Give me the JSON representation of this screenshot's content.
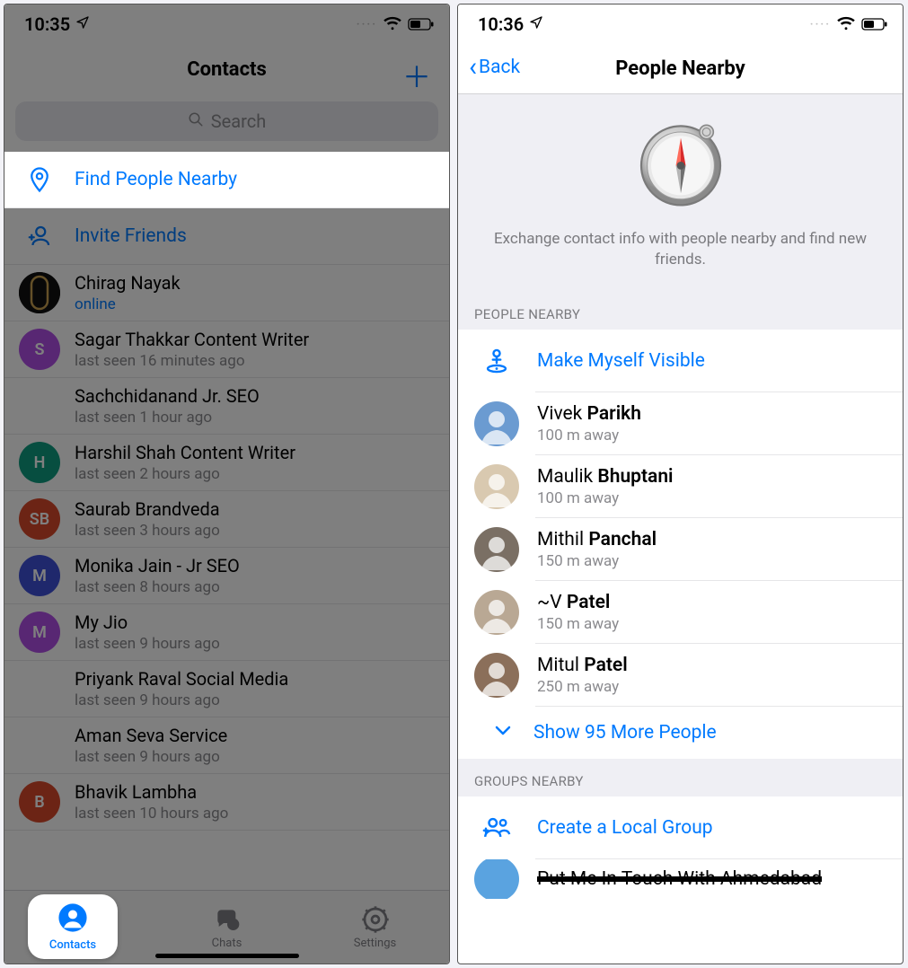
{
  "left": {
    "status": {
      "time": "10:35",
      "dots": "····"
    },
    "nav": {
      "title": "Contacts"
    },
    "search": {
      "placeholder": "Search"
    },
    "actions": {
      "find_nearby": "Find People Nearby",
      "invite": "Invite Friends"
    },
    "contacts": [
      {
        "name": "Chirag Nayak",
        "sub": "online",
        "sub_blue": true,
        "initials": "",
        "color": "#1b1b1b"
      },
      {
        "name": "Sagar Thakkar Content Writer",
        "sub": "last seen 16 minutes ago",
        "initials": "S",
        "color": "#b04fe6"
      },
      {
        "name": "Sachchidanand Jr. SEO",
        "sub": "last seen 1 hour ago",
        "indent": true
      },
      {
        "name": "Harshil Shah Content Writer",
        "sub": "last seen 2 hours ago",
        "initials": "H",
        "color": "#0f9d80"
      },
      {
        "name": "Saurab Brandveda",
        "sub": "last seen 3 hours ago",
        "initials": "SB",
        "color": "#d9482b"
      },
      {
        "name": "Monika Jain - Jr SEO",
        "sub": "last seen 8 hours ago",
        "initials": "M",
        "color": "#3f51d8"
      },
      {
        "name": "My Jio",
        "sub": "last seen 9 hours ago",
        "initials": "M",
        "color": "#b04fe6"
      },
      {
        "name": "Priyank Raval Social Media",
        "sub": "last seen 9 hours ago",
        "indent": true
      },
      {
        "name": "Aman Seva Service",
        "sub": "last seen 9 hours ago",
        "indent": true
      },
      {
        "name": "Bhavik Lambha",
        "sub": "last seen 10 hours ago",
        "initials": "B",
        "color": "#d9482b"
      }
    ],
    "tabs": {
      "contacts": "Contacts",
      "chats": "Chats",
      "settings": "Settings"
    }
  },
  "right": {
    "status": {
      "time": "10:36",
      "dots": "····"
    },
    "nav": {
      "back": "Back",
      "title": "People Nearby"
    },
    "hero": "Exchange contact info with people nearby and find new friends.",
    "section_people": "PEOPLE NEARBY",
    "make_visible": "Make Myself Visible",
    "people": [
      {
        "first": "Vivek ",
        "last": "Parikh",
        "sub": "100 m away",
        "bg": "#6b9bd1"
      },
      {
        "first": "Maulik ",
        "last": "Bhuptani",
        "sub": "100 m away",
        "bg": "#d9c9b0"
      },
      {
        "first": "Mithil ",
        "last": "Panchal",
        "sub": "150 m away",
        "bg": "#7a6f64"
      },
      {
        "first": "~V ",
        "last": "Patel",
        "sub": "150 m away",
        "bg": "#b9a894"
      },
      {
        "first": "Mitul ",
        "last": "Patel",
        "sub": "250 m away",
        "bg": "#8b6f5a"
      }
    ],
    "show_more": "Show 95 More People",
    "section_groups": "GROUPS NEARBY",
    "create_group": "Create a Local Group",
    "group_partial": "Put Me In Touch With Ahmedabad"
  }
}
